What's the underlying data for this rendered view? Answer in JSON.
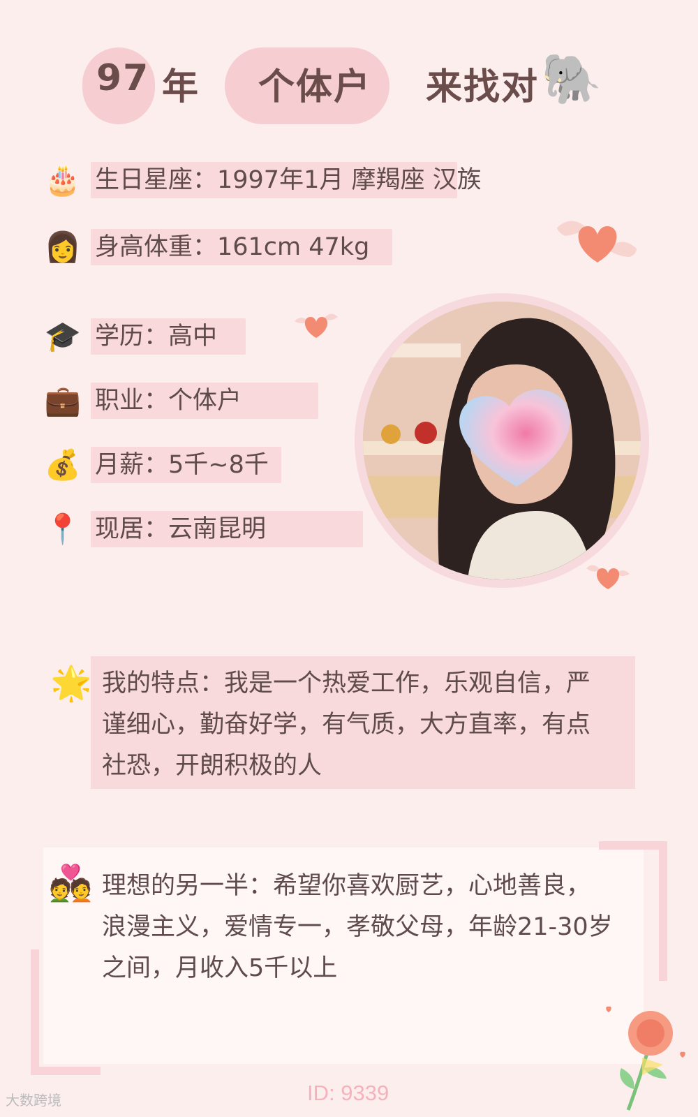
{
  "title": {
    "part1": "97",
    "part2": "年",
    "part3": "个体户",
    "part4": "来找对",
    "emoji": "🐘"
  },
  "info": {
    "birthday": {
      "icon": "🎂",
      "text": "生日星座：1997年1月 摩羯座 汉族"
    },
    "height_weight": {
      "icon": "👩",
      "text": "身高体重：161cm 47kg"
    },
    "education": {
      "icon": "🎓",
      "text": "学历：高中"
    },
    "job": {
      "icon": "💼",
      "text": "职业：个体户"
    },
    "salary": {
      "icon": "💰",
      "text": "月薪：5千~8千"
    },
    "location": {
      "icon": "📍",
      "text": "现居：云南昆明"
    }
  },
  "traits": {
    "icon": "🌟",
    "line1": "我的特点：我是一个热爱工作，乐观自信，严",
    "line2": "谨细心，勤奋好学，有气质，大方直率，有点",
    "line3": "社恐，开朗积极的人"
  },
  "ideal": {
    "icon": "💑",
    "line1": "理想的另一半：希望你喜欢厨艺，心地善良，",
    "line2": "浪漫主义，爱情专一，孝敬父母，年龄21-30岁",
    "line3": "之间，月收入5千以上"
  },
  "footer": {
    "id": "ID: 9339",
    "watermark": "大数跨境"
  },
  "colors": {
    "background": "#fdeeee",
    "bar": "#f9d9dc",
    "title_bubble": "#f6cdd0",
    "title_text": "#6a4c4a",
    "accent_heart": "#f08a78"
  }
}
